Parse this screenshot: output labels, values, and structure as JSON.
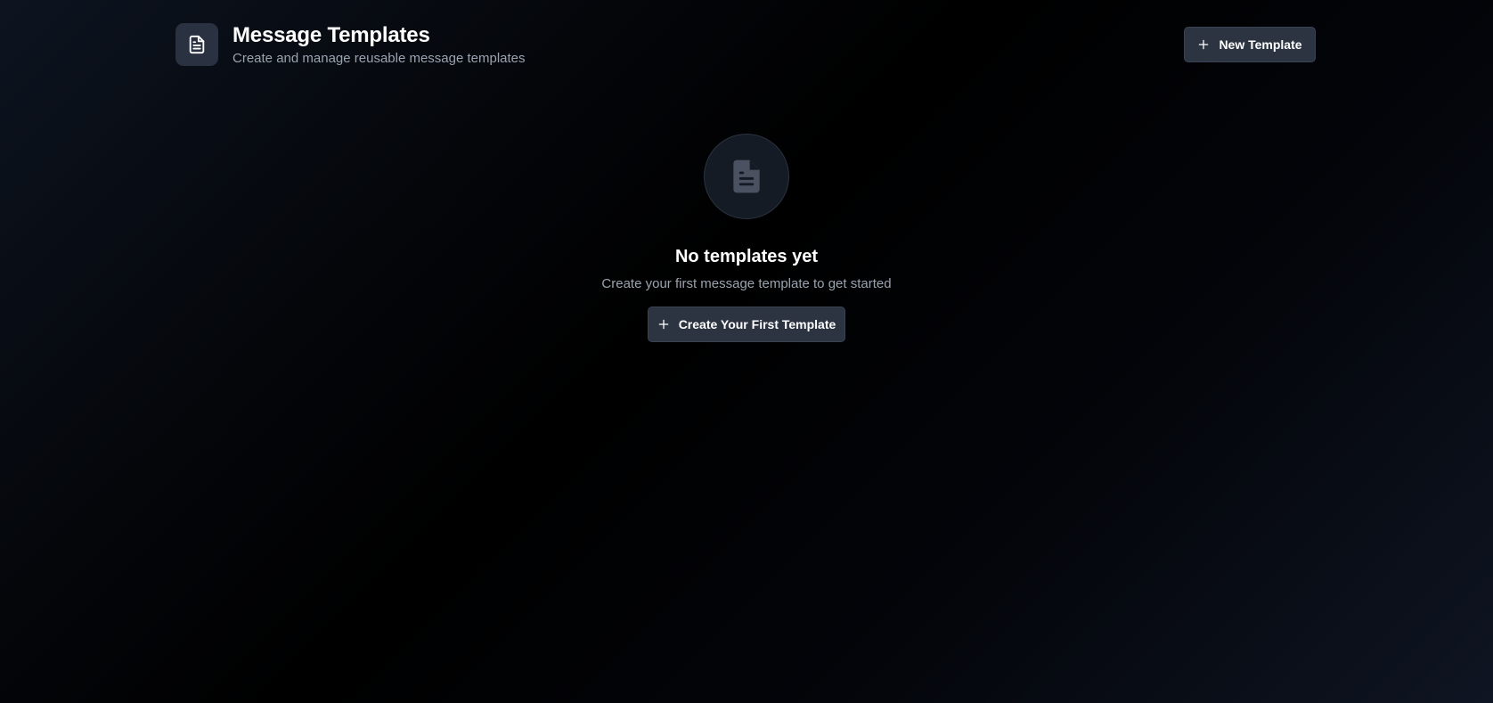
{
  "header": {
    "icon": "file-text-icon",
    "title": "Message Templates",
    "subtitle": "Create and manage reusable message templates",
    "new_template_label": "New Template"
  },
  "empty_state": {
    "icon": "file-text-icon",
    "title": "No templates yet",
    "subtitle": "Create your first message template to get started",
    "cta_label": "Create Your First Template"
  },
  "colors": {
    "button_bg": "#2c3442",
    "icon_tile_bg": "#2a3140",
    "muted_text": "#9aa3af"
  }
}
